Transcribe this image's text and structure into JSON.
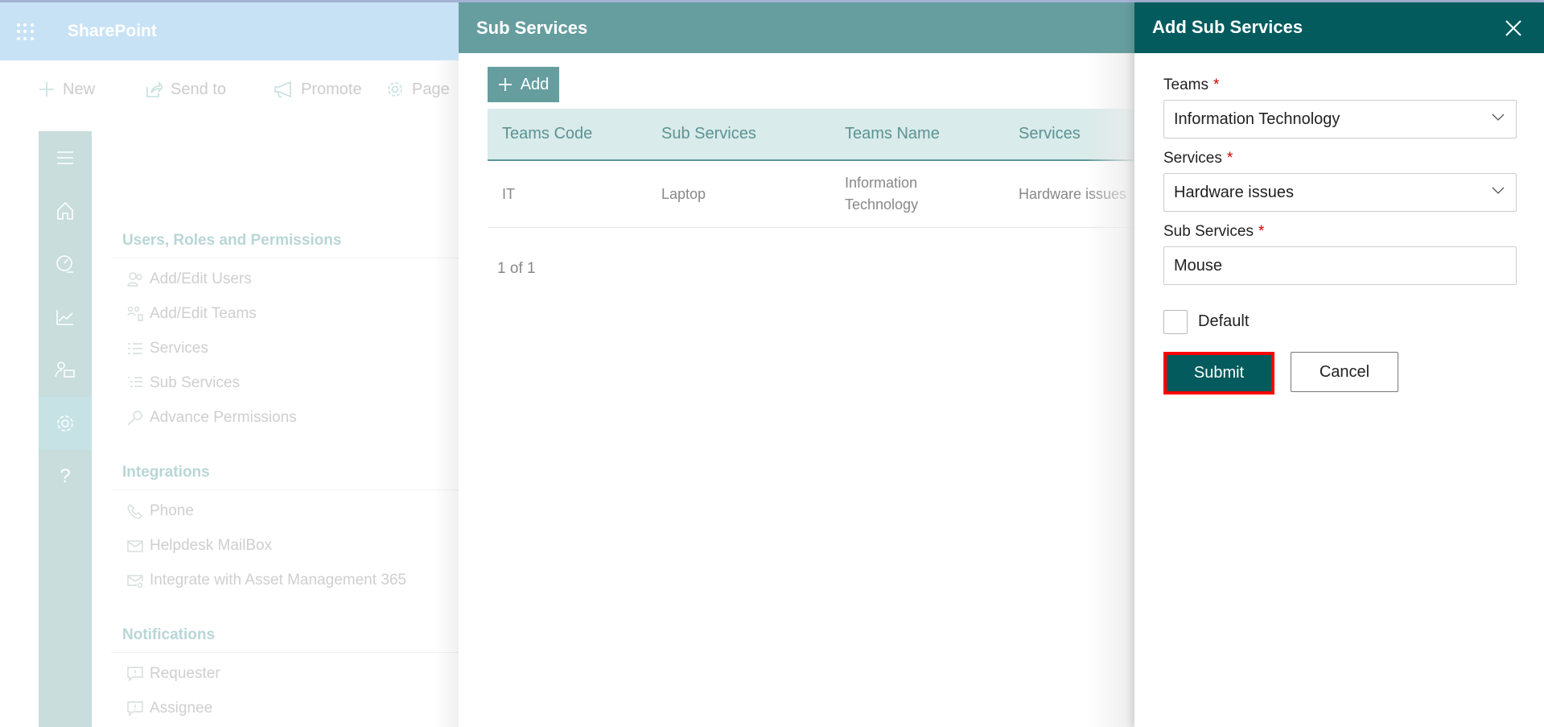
{
  "suite": {
    "brand": "SharePoint"
  },
  "commandbar": {
    "new": "New",
    "send_to": "Send to",
    "promote": "Promote",
    "page": "Page"
  },
  "rail": {
    "icons": [
      "menu-icon",
      "home-icon",
      "dashboard-icon",
      "chart-icon",
      "users-icon",
      "settings-icon",
      "help-icon"
    ],
    "help_glyph": "?"
  },
  "settings": {
    "sections": [
      {
        "title": "Users, Roles and Permissions",
        "items": [
          "Add/Edit Users",
          "Add/Edit Teams",
          "Services",
          "Sub Services",
          "Advance Permissions"
        ]
      },
      {
        "title": "Integrations",
        "items": [
          "Phone",
          "Helpdesk MailBox",
          "Integrate with Asset Management 365"
        ]
      },
      {
        "title": "Notifications",
        "items": [
          "Requester",
          "Assignee"
        ]
      }
    ]
  },
  "sub_services_panel": {
    "title": "Sub Services",
    "add_label": "Add",
    "columns": [
      "Teams Code",
      "Sub Services",
      "Teams Name",
      "Services"
    ],
    "rows": [
      {
        "teams_code": "IT",
        "sub_services": "Laptop",
        "teams_name": "Information Technology",
        "services": "Hardware issues"
      }
    ],
    "pager": "1 of 1"
  },
  "add_panel": {
    "title": "Add Sub Services",
    "teams_label": "Teams",
    "teams_value": "Information Technology",
    "services_label": "Services",
    "services_value": "Hardware issues",
    "sub_services_label": "Sub Services",
    "sub_services_value": "Mouse",
    "required_mark": "*",
    "default_label": "Default",
    "default_checked": false,
    "submit_label": "Submit",
    "cancel_label": "Cancel"
  },
  "colors": {
    "header_dark": "#035b5e",
    "header_mid": "#669e9f",
    "highlight": "#ff0000"
  }
}
